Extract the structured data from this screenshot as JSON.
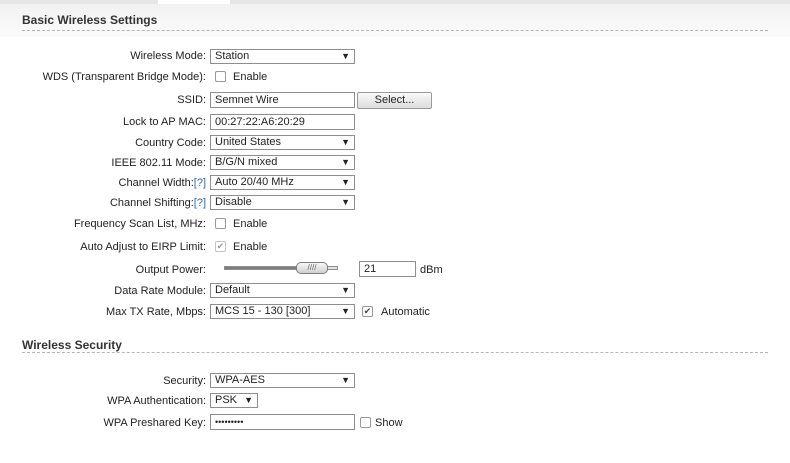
{
  "basic": {
    "title": "Basic Wireless Settings",
    "wireless_mode": {
      "label": "Wireless Mode:",
      "value": "Station"
    },
    "wds": {
      "label": "WDS (Transparent Bridge Mode):",
      "checkbox_label": "Enable",
      "checked": false
    },
    "ssid": {
      "label": "SSID:",
      "value": "Semnet Wire",
      "button": "Select..."
    },
    "lock_ap": {
      "label": "Lock to AP MAC:",
      "value": "00:27:22:A6:20:29"
    },
    "country": {
      "label": "Country Code:",
      "value": "United States"
    },
    "ieee_mode": {
      "label": "IEEE 802.11 Mode:",
      "value": "B/G/N mixed"
    },
    "channel_width": {
      "label": "Channel Width:",
      "help": "[?]",
      "value": "Auto 20/40 MHz"
    },
    "channel_shifting": {
      "label": "Channel Shifting:",
      "help": "[?]",
      "value": "Disable"
    },
    "freq_scan": {
      "label": "Frequency Scan List, MHz:",
      "checkbox_label": "Enable",
      "checked": false
    },
    "eirp": {
      "label": "Auto Adjust to EIRP Limit:",
      "checkbox_label": "Enable",
      "checked": true,
      "disabled": true
    },
    "output_power": {
      "label": "Output Power:",
      "value": "21",
      "unit": "dBm",
      "slider_fraction": 0.72
    },
    "data_rate": {
      "label": "Data Rate Module:",
      "value": "Default"
    },
    "max_tx": {
      "label": "Max TX Rate, Mbps:",
      "value": "MCS 15 - 130 [300]",
      "checkbox_label": "Automatic",
      "checked": true
    }
  },
  "security": {
    "title": "Wireless Security",
    "security": {
      "label": "Security:",
      "value": "WPA-AES"
    },
    "wpa_auth": {
      "label": "WPA Authentication:",
      "value": "PSK"
    },
    "wpa_key": {
      "label": "WPA Preshared Key:",
      "value": "•••••••••",
      "checkbox_label": "Show",
      "checked": false
    }
  },
  "icons": {
    "dropdown": "▼",
    "check": "✔",
    "slider_grip": "////"
  }
}
